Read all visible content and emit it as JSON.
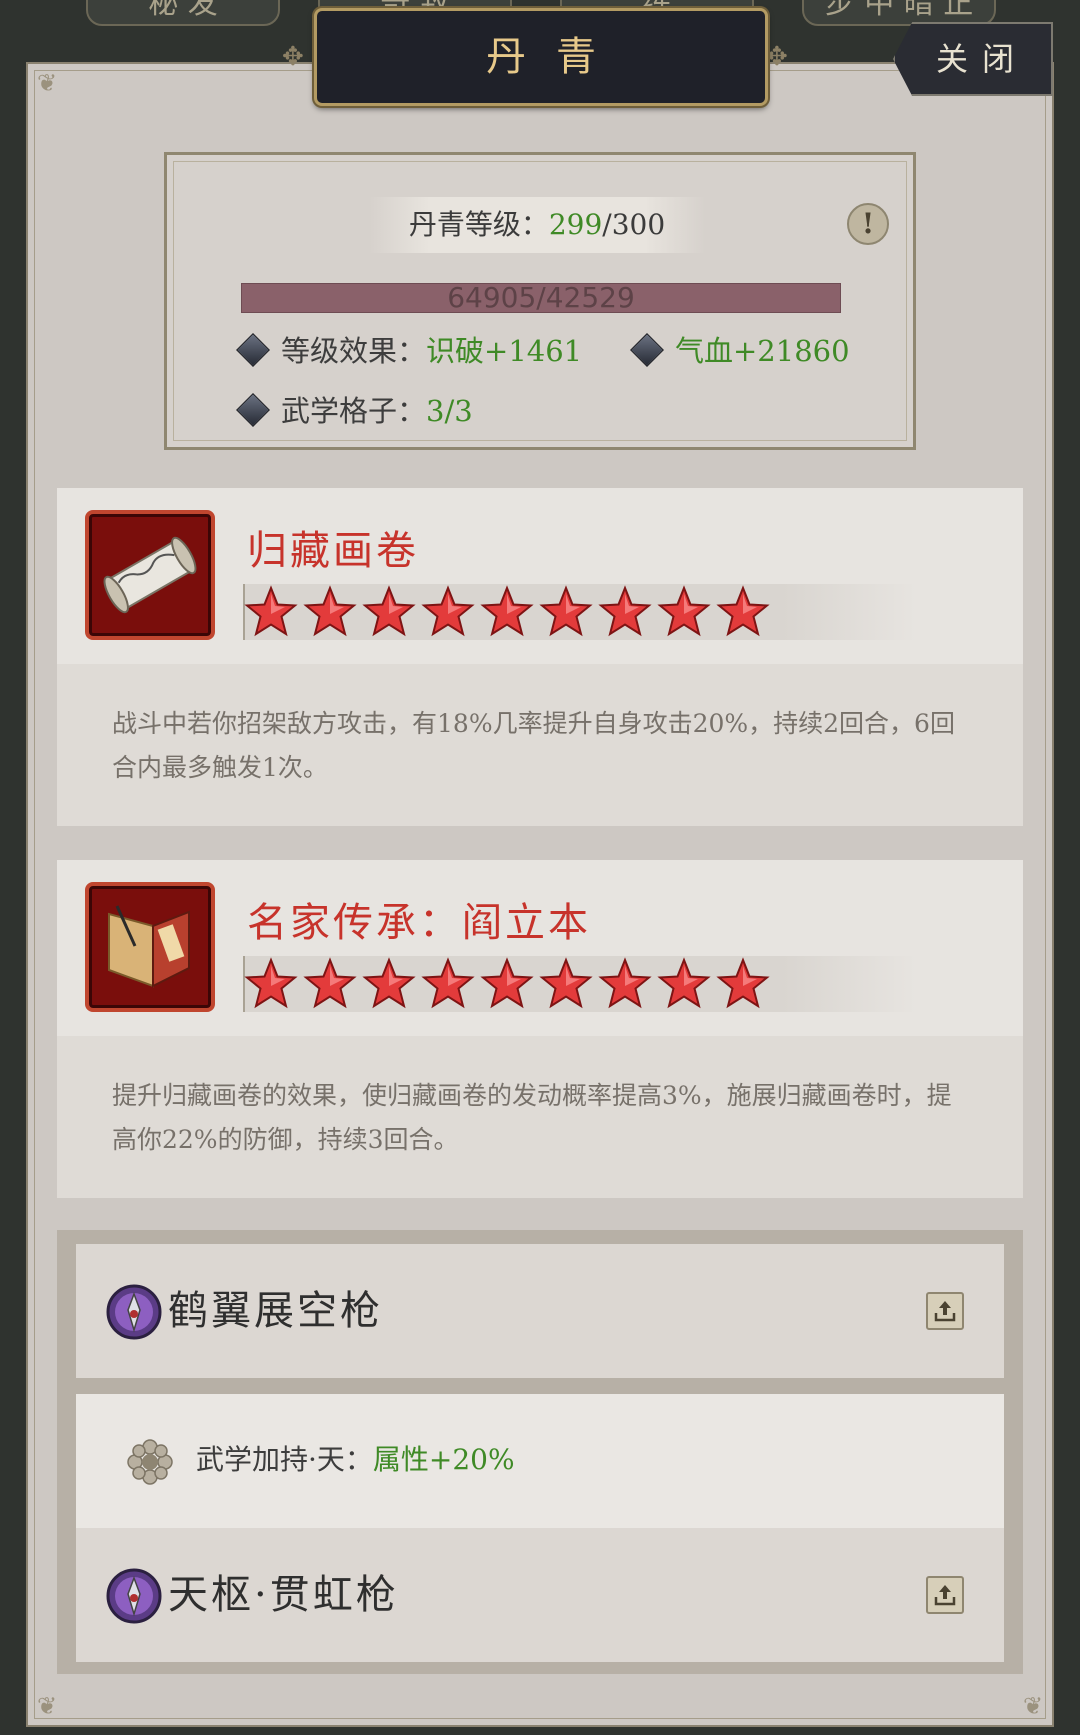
{
  "top_tabs": [
    "秘 发",
    "奇 致",
    "练",
    "步 中 暗 正"
  ],
  "title": "丹青",
  "close_label": "关闭",
  "info": {
    "level_label": "丹青等级：",
    "level_value": "299",
    "level_max": "/300",
    "xp_text": "64905/42529",
    "xp_progress": 1.0,
    "effect_label": "等级效果：",
    "effect_value": "识破+1461",
    "effect2_value": "气血+21860",
    "slot_label": "武学格子：",
    "slot_value": "3/3"
  },
  "skills": [
    {
      "name": "归藏画卷",
      "stars": 9,
      "icon": "scroll-icon",
      "description": "战斗中若你招架敌方攻击，有18%几率提升自身攻击20%，持续2回合，6回合内最多触发1次。"
    },
    {
      "name": "名家传承：阎立本",
      "stars": 9,
      "icon": "book-icon",
      "description": "提升归藏画卷的效果，使归藏画卷的发动概率提高3%，施展归藏画卷时，提高你22%的防御，持续3回合。"
    }
  ],
  "wuxue": {
    "item1": "鹤翼展空枪",
    "bonus_label": "武学加持·天：",
    "bonus_value": "属性+20%",
    "item2": "天枢·贯虹枪"
  },
  "colors": {
    "accent_red": "#c7332b",
    "green": "#3f8a26",
    "title_gold": "#e7c98a"
  }
}
